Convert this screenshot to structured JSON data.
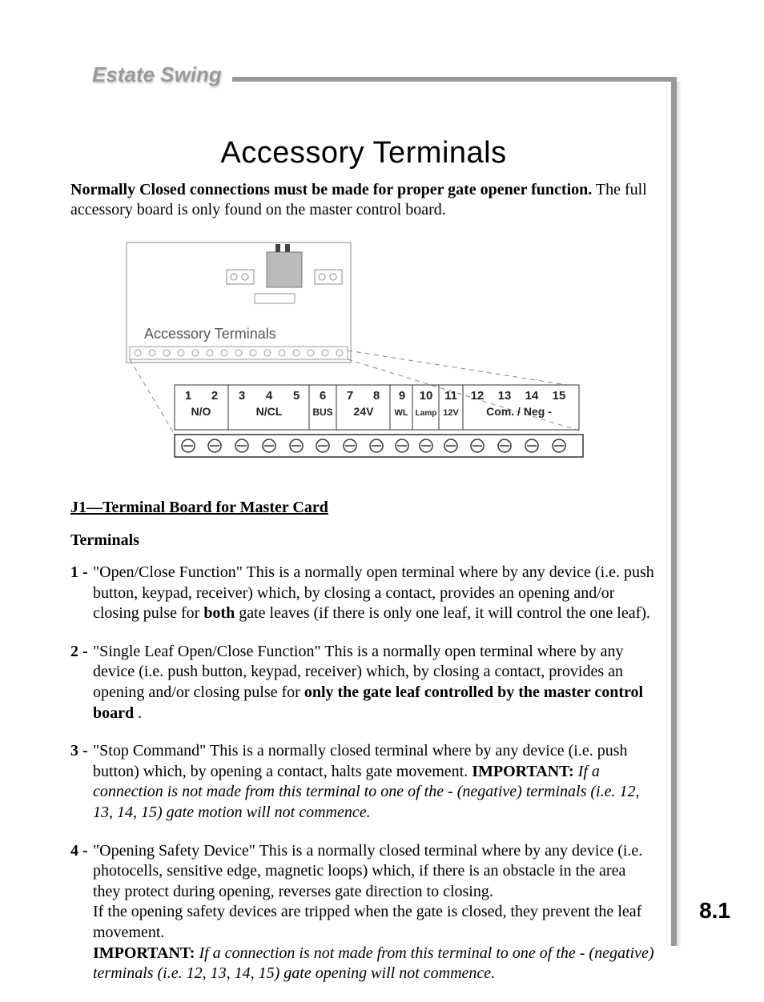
{
  "brand": "Estate Swing",
  "page_number": "8.1",
  "title": "Accessory Terminals",
  "intro_bold": "Normally Closed connections must be made for proper gate opener function.",
  "intro_rest": " The full accessory board is only found on the master control board.",
  "diagram": {
    "block_label": "Accessory Terminals",
    "numbers": [
      "1",
      "2",
      "3",
      "4",
      "5",
      "6",
      "7",
      "8",
      "9",
      "10",
      "11",
      "12",
      "13",
      "14",
      "15"
    ],
    "group_labels": {
      "g12": "N/O",
      "g345": "N/CL",
      "g6": "BUS",
      "g78": "24V",
      "g9": "WL",
      "g10": "Lamp",
      "g11": "12V",
      "g1215": "Com. / Neg -"
    }
  },
  "section_heading": "J1—Terminal Board for Master Card",
  "terminals_heading": "Terminals",
  "terminals": [
    {
      "num": "1 -",
      "pre": "\"Open/Close Function\" This is a normally open terminal where by any device (i.e. push button, keypad, receiver) which, by closing a contact, provides an opening and/or closing pulse for ",
      "bold": "both",
      "post": " gate leaves (if there is only one leaf, it will control the one leaf)."
    },
    {
      "num": "2 -",
      "pre": "\"Single Leaf Open/Close Function\" This is a normally open terminal where by any device (i.e. push button, keypad, receiver) which, by closing a contact, provides an opening and/or closing pulse for ",
      "bold": "only the gate leaf controlled by the master control board",
      "post": " ."
    },
    {
      "num": "3 -",
      "pre": "\"Stop Command\" This is a normally closed terminal where by any device (i.e. push button) which, by opening a contact, halts gate movement. ",
      "imp": "IMPORTANT:",
      "ital": " If a connection is not made from this terminal to one of the - (negative) terminals (i.e. 12, 13, 14, 15) gate motion will not commence."
    },
    {
      "num": "4 -",
      "pre": "\"Opening Safety Device\" This is a normally closed terminal where by any device (i.e. photocells, sensitive edge, magnetic loops) which, if there is an obstacle in the area they protect during opening, reverses gate direction to closing.",
      "mid": "If the opening safety devices are tripped when the gate is closed, they prevent the leaf movement.",
      "imp": "IMPORTANT:",
      "ital": " If a connection is not made from this terminal to one of the - (negative) terminals (i.e. 12, 13, 14, 15) gate opening will not commence."
    }
  ]
}
